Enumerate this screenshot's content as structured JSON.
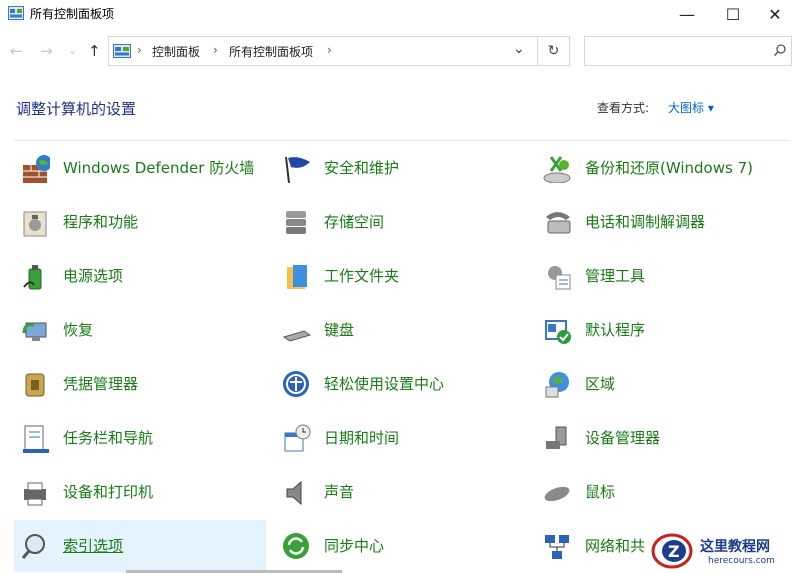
{
  "window": {
    "title": "所有控制面板项",
    "minimize_glyph": "—",
    "maximize_glyph": "☐",
    "close_glyph": "✕"
  },
  "nav": {
    "back_glyph": "←",
    "forward_glyph": "→",
    "recent_glyph": "⌄",
    "up_glyph": "↑"
  },
  "address": {
    "crumbs": [
      "控制面板",
      "所有控制面板项"
    ],
    "sep": "›",
    "dropdown_glyph": "⌄",
    "refresh_glyph": "↻"
  },
  "search": {
    "placeholder": ""
  },
  "header": {
    "heading": "调整计算机的设置",
    "view_by_label": "查看方式:",
    "view_by_value": "大图标 ▾"
  },
  "items": [
    {
      "label": "Windows Defender 防火墙",
      "icon": "firewall-icon"
    },
    {
      "label": "安全和维护",
      "icon": "flag-icon"
    },
    {
      "label": "备份和还原(Windows 7)",
      "icon": "backup-icon"
    },
    {
      "label": "程序和功能",
      "icon": "programs-icon"
    },
    {
      "label": "存储空间",
      "icon": "storage-icon"
    },
    {
      "label": "电话和调制解调器",
      "icon": "phone-modem-icon"
    },
    {
      "label": "电源选项",
      "icon": "power-icon"
    },
    {
      "label": "工作文件夹",
      "icon": "work-folders-icon"
    },
    {
      "label": "管理工具",
      "icon": "admin-tools-icon"
    },
    {
      "label": "恢复",
      "icon": "recovery-icon"
    },
    {
      "label": "键盘",
      "icon": "keyboard-icon"
    },
    {
      "label": "默认程序",
      "icon": "default-programs-icon"
    },
    {
      "label": "凭据管理器",
      "icon": "credential-icon"
    },
    {
      "label": "轻松使用设置中心",
      "icon": "ease-of-access-icon"
    },
    {
      "label": "区域",
      "icon": "region-icon"
    },
    {
      "label": "任务栏和导航",
      "icon": "taskbar-icon"
    },
    {
      "label": "日期和时间",
      "icon": "datetime-icon"
    },
    {
      "label": "设备管理器",
      "icon": "device-manager-icon"
    },
    {
      "label": "设备和打印机",
      "icon": "printer-icon"
    },
    {
      "label": "声音",
      "icon": "sound-icon"
    },
    {
      "label": "鼠标",
      "icon": "mouse-icon"
    },
    {
      "label": "索引选项",
      "icon": "indexing-icon",
      "selected": true
    },
    {
      "label": "同步中心",
      "icon": "sync-icon"
    },
    {
      "label": "网络和共",
      "icon": "network-icon"
    }
  ],
  "watermark": {
    "title": "这里教程网",
    "url": "herecours.com"
  },
  "colors": {
    "link_green": "#1a7b17",
    "heading_blue": "#1e3287",
    "selection": "#e5f3ff"
  }
}
